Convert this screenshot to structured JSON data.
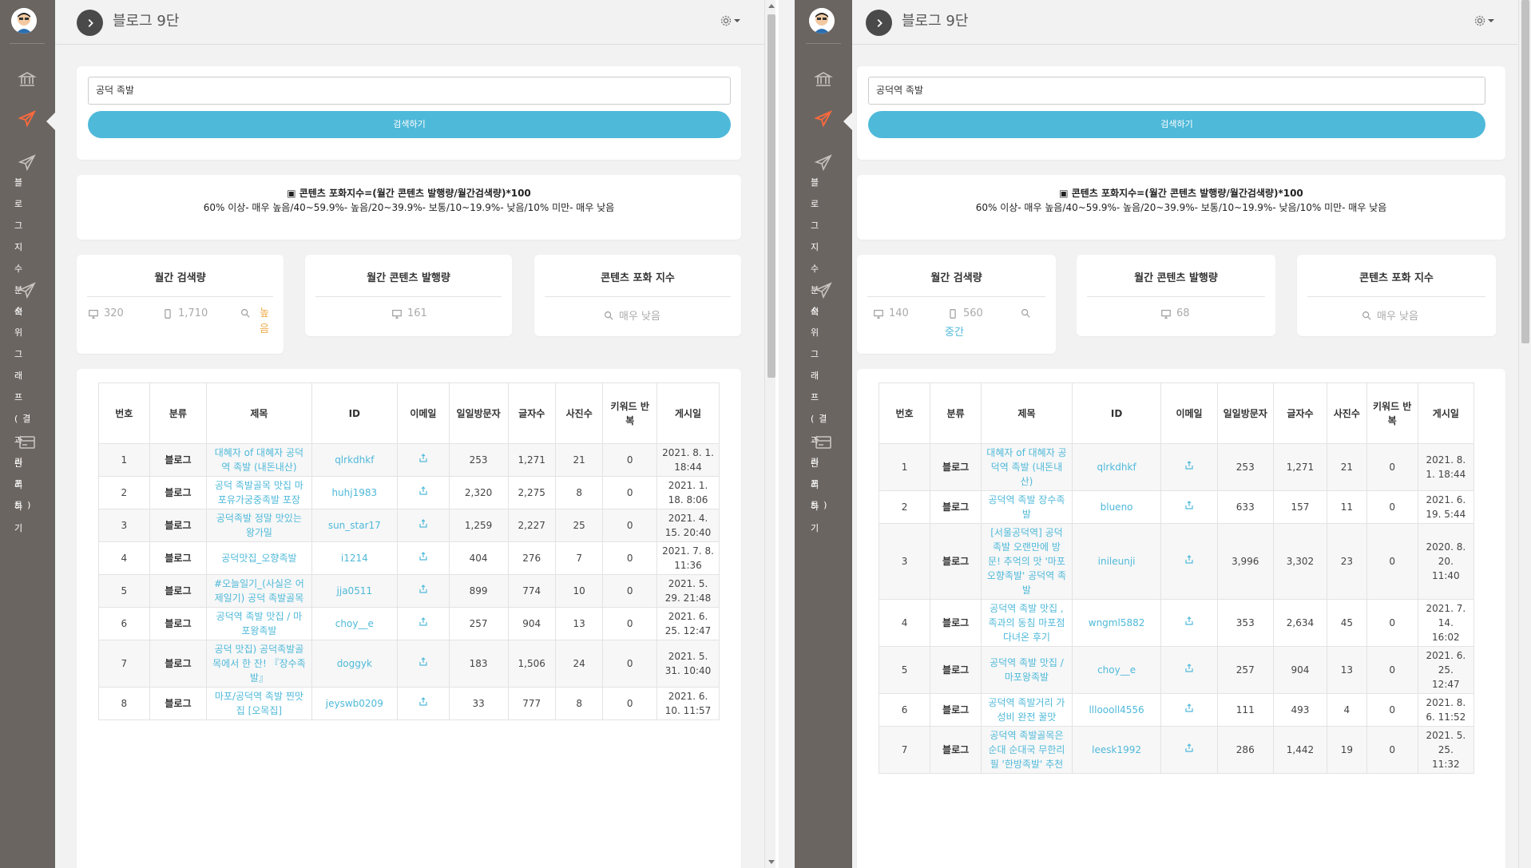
{
  "app_title": "블로그 9단",
  "sidebar": {
    "blog_index_label": "블로그지수분석",
    "rank_graph_label": "순위그래프(결과리포트)",
    "manage_label": "관리하기"
  },
  "formula": {
    "line1": "▣ 콘텐츠 포화지수=(월간 콘텐츠 발행량/월간검색량)*100",
    "line2": "60% 이상- 매우 높음/40~59.9%- 높음/20~39.9%- 보통/10~19.9%- 낮음/10% 미만- 매우 낮음"
  },
  "search_button": "검색하기",
  "stats_labels": {
    "monthly_search": "월간 검색량",
    "monthly_content": "월간 콘텐츠 발행량",
    "saturation": "콘텐츠 포화 지수"
  },
  "table_headers": [
    "번호",
    "분류",
    "제목",
    "ID",
    "이메일",
    "일일방문자",
    "글자수",
    "사진수",
    "키워드 반복",
    "게시일"
  ],
  "left": {
    "query": "공덕 족발",
    "pc_search": "320",
    "mobile_search": "1,710",
    "search_level": "높음",
    "content_pc": "161",
    "saturation": "매우 낮음",
    "rows": [
      {
        "no": "1",
        "cat": "블로그",
        "title": "대혜자 of 대혜자 공덕역 족발 (내돈내산)",
        "id": "qlrkdhkf",
        "visitors": "253",
        "chars": "1,271",
        "photos": "21",
        "kw": "0",
        "date": "2021. 8. 1. 18:44"
      },
      {
        "no": "2",
        "cat": "블로그",
        "title": "공덕 족발골목 맛집 마포유가궁중족발 포장",
        "id": "huhj1983",
        "visitors": "2,320",
        "chars": "2,275",
        "photos": "8",
        "kw": "0",
        "date": "2021. 1. 18. 8:06"
      },
      {
        "no": "3",
        "cat": "블로그",
        "title": "공덕족발 정말 맛있는 왕가밀",
        "id": "sun_star17",
        "visitors": "1,259",
        "chars": "2,227",
        "photos": "25",
        "kw": "0",
        "date": "2021. 4. 15. 20:40"
      },
      {
        "no": "4",
        "cat": "블로그",
        "title": "공덕맛집_오향족발",
        "id": "i1214",
        "visitors": "404",
        "chars": "276",
        "photos": "7",
        "kw": "0",
        "date": "2021. 7. 8. 11:36"
      },
      {
        "no": "5",
        "cat": "블로그",
        "title": "#오늘일기_(사실은 어제일기) 공덕 족발골목",
        "id": "jja0511",
        "visitors": "899",
        "chars": "774",
        "photos": "10",
        "kw": "0",
        "date": "2021. 5. 29. 21:48"
      },
      {
        "no": "6",
        "cat": "블로그",
        "title": "공덕역 족발 맛집 / 마포왕족발",
        "id": "choy__e",
        "visitors": "257",
        "chars": "904",
        "photos": "13",
        "kw": "0",
        "date": "2021. 6. 25. 12:47"
      },
      {
        "no": "7",
        "cat": "블로그",
        "title": "공덕 맛집) 공덕족발골목에서 한 잔! 『장수족발』",
        "id": "doggyk",
        "visitors": "183",
        "chars": "1,506",
        "photos": "24",
        "kw": "0",
        "date": "2021. 5. 31. 10:40"
      },
      {
        "no": "8",
        "cat": "블로그",
        "title": "마포/공덕역 족발 찐맛집 [오목집]",
        "id": "jeyswb0209",
        "visitors": "33",
        "chars": "777",
        "photos": "8",
        "kw": "0",
        "date": "2021. 6. 10. 11:57"
      }
    ]
  },
  "right": {
    "query": "공덕역 족발",
    "pc_search": "140",
    "mobile_search": "560",
    "search_level": "중간",
    "content_pc": "68",
    "saturation": "매우 낮음",
    "rows": [
      {
        "no": "1",
        "cat": "블로그",
        "title": "대혜자 of 대혜자 공덕역 족발 (내돈내산)",
        "id": "qlrkdhkf",
        "visitors": "253",
        "chars": "1,271",
        "photos": "21",
        "kw": "0",
        "date": "2021. 8. 1. 18:44"
      },
      {
        "no": "2",
        "cat": "블로그",
        "title": "공덕역 족발 장수족발",
        "id": "blueno",
        "visitors": "633",
        "chars": "157",
        "photos": "11",
        "kw": "0",
        "date": "2021. 6. 19. 5:44"
      },
      {
        "no": "3",
        "cat": "블로그",
        "title": "[서울공덕역] 공덕 족발 오랜만에 방문! 추억의 맛 '마포 오향족발' 공덕역 족발",
        "id": "inileunji",
        "visitors": "3,996",
        "chars": "3,302",
        "photos": "23",
        "kw": "0",
        "date": "2020. 8. 20. 11:40"
      },
      {
        "no": "4",
        "cat": "블로그",
        "title": "공덕역 족발 맛집 , 족과의 동침 마포점 다녀온 후기",
        "id": "wngml5882",
        "visitors": "353",
        "chars": "2,634",
        "photos": "45",
        "kw": "0",
        "date": "2021. 7. 14. 16:02"
      },
      {
        "no": "5",
        "cat": "블로그",
        "title": "공덕역 족발 맛집 / 마포왕족발",
        "id": "choy__e",
        "visitors": "257",
        "chars": "904",
        "photos": "13",
        "kw": "0",
        "date": "2021. 6. 25. 12:47"
      },
      {
        "no": "6",
        "cat": "블로그",
        "title": "공덕역 족발거리 가성비 완전 꿀맛",
        "id": "llloooll4556",
        "visitors": "111",
        "chars": "493",
        "photos": "4",
        "kw": "0",
        "date": "2021. 8. 6. 11:52"
      },
      {
        "no": "7",
        "cat": "블로그",
        "title": "공덕역 족발골목은 순대 순대국 무한리필 '한방족발' 추천",
        "id": "leesk1992",
        "visitors": "286",
        "chars": "1,442",
        "photos": "19",
        "kw": "0",
        "date": "2021. 5. 25. 11:32"
      }
    ]
  }
}
